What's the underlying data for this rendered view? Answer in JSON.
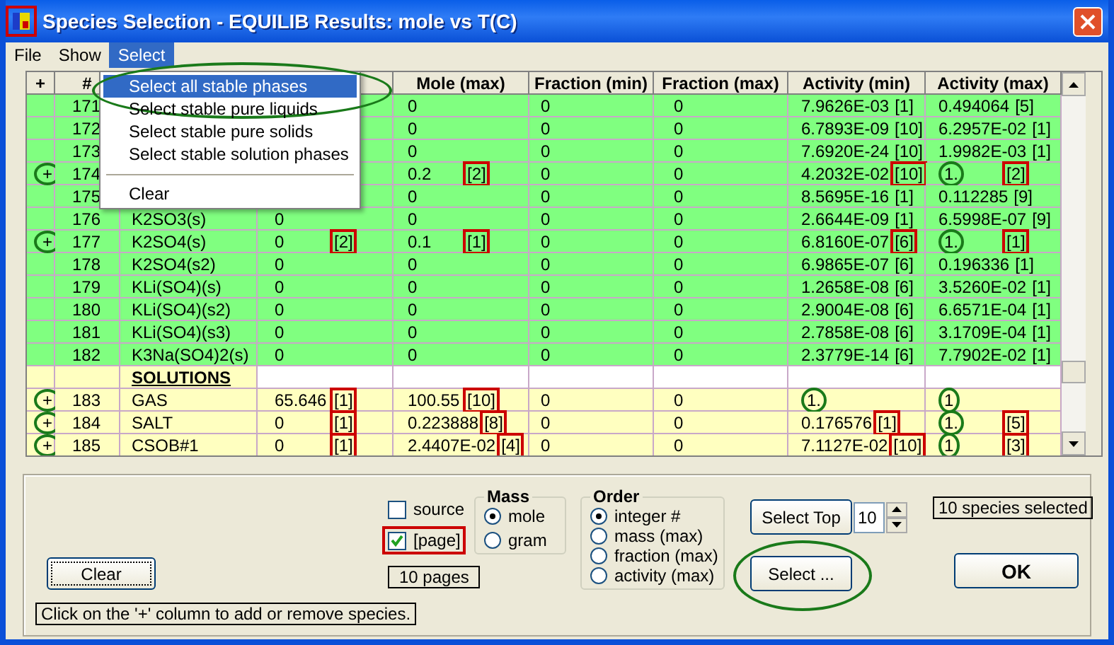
{
  "window": {
    "title": "Species Selection - EQUILIB Results: mole vs T(C)",
    "icon_boxed": true
  },
  "menu": [
    {
      "label": "File",
      "selected": false
    },
    {
      "label": "Show",
      "selected": false
    },
    {
      "label": "Select",
      "selected": true
    }
  ],
  "dropdown": [
    {
      "kind": "item",
      "label": "Select all stable phases",
      "selected": true,
      "circled": true
    },
    {
      "kind": "item",
      "label": "Select stable pure liquids",
      "selected": false,
      "circled": false
    },
    {
      "kind": "item",
      "label": "Select stable pure solids",
      "selected": false,
      "circled": false
    },
    {
      "kind": "item",
      "label": "Select stable solution phases",
      "selected": false,
      "circled": false
    },
    {
      "kind": "separator"
    },
    {
      "kind": "item",
      "label": "Clear",
      "selected": false,
      "circled": false
    }
  ],
  "table": {
    "header": {
      "plus": "+",
      "number": "#",
      "mole_max": "Mole (max)",
      "fraction_min": "Fraction (min)",
      "fraction_max": "Fraction (max)",
      "activity_min": "Activity (min)",
      "activity_max": "Activity (max)"
    },
    "rows": [
      {
        "kind": "pure",
        "number": "171",
        "mole_max": {
          "text": "0"
        },
        "fraction_min": {
          "text": "0"
        },
        "fraction_max": {
          "text": "0"
        },
        "activity_min": {
          "text": "7.9626E-03",
          "tag": "[1]"
        },
        "activity_max": {
          "text": "0.494064",
          "tag": "[5]"
        }
      },
      {
        "kind": "pure",
        "number": "172",
        "mole_max": {
          "text": "0"
        },
        "fraction_min": {
          "text": "0"
        },
        "fraction_max": {
          "text": "0"
        },
        "activity_min": {
          "text": "6.7893E-09",
          "tag": "[10]"
        },
        "activity_max": {
          "text": "6.2957E-02",
          "tag": "[1]"
        }
      },
      {
        "kind": "pure",
        "number": "173",
        "mole_max": {
          "text": "0"
        },
        "fraction_min": {
          "text": "0"
        },
        "fraction_max": {
          "text": "0"
        },
        "activity_min": {
          "text": "7.6920E-24",
          "tag": "[10]"
        },
        "activity_max": {
          "text": "1.9982E-03",
          "tag": "[1]"
        }
      },
      {
        "kind": "pure",
        "plus": "+",
        "plus_circled": true,
        "number": "174",
        "mole_max": {
          "text": "0.2",
          "tag": "[2]",
          "boxed": true
        },
        "fraction_min": {
          "text": "0"
        },
        "fraction_max": {
          "text": "0"
        },
        "activity_min": {
          "text": "4.2032E-02",
          "tag": "[10]",
          "boxed": true
        },
        "activity_max": {
          "text": "1.",
          "circled": true,
          "tag": "[2]",
          "boxed": true
        }
      },
      {
        "kind": "pure",
        "number": "175",
        "mole_max": {
          "text": "0"
        },
        "fraction_min": {
          "text": "0"
        },
        "fraction_max": {
          "text": "0"
        },
        "activity_min": {
          "text": "8.5695E-16",
          "tag": "[1]"
        },
        "activity_max": {
          "text": "0.112285",
          "tag": "[9]"
        }
      },
      {
        "kind": "pure",
        "number": "176",
        "name": "K2SO3(s)",
        "mole_min": {
          "text": "0"
        },
        "mole_max": {
          "text": "0"
        },
        "fraction_min": {
          "text": "0"
        },
        "fraction_max": {
          "text": "0"
        },
        "activity_min": {
          "text": "2.6644E-09",
          "tag": "[1]"
        },
        "activity_max": {
          "text": "6.5998E-07",
          "tag": "[9]"
        }
      },
      {
        "kind": "pure",
        "plus": "+",
        "plus_circled": true,
        "number": "177",
        "name": "K2SO4(s)",
        "mole_min": {
          "text": "0",
          "tag": "[2]",
          "boxed": true
        },
        "mole_max": {
          "text": "0.1",
          "tag": "[1]",
          "boxed": true
        },
        "fraction_min": {
          "text": "0"
        },
        "fraction_max": {
          "text": "0"
        },
        "activity_min": {
          "text": "6.8160E-07",
          "tag": "[6]",
          "boxed": true
        },
        "activity_max": {
          "text": "1.",
          "circled": true,
          "tag": "[1]",
          "boxed": true
        }
      },
      {
        "kind": "pure",
        "number": "178",
        "name": "K2SO4(s2)",
        "mole_min": {
          "text": "0"
        },
        "mole_max": {
          "text": "0"
        },
        "fraction_min": {
          "text": "0"
        },
        "fraction_max": {
          "text": "0"
        },
        "activity_min": {
          "text": "6.9865E-07",
          "tag": "[6]"
        },
        "activity_max": {
          "text": "0.196336",
          "tag": "[1]"
        }
      },
      {
        "kind": "pure",
        "number": "179",
        "name": "KLi(SO4)(s)",
        "mole_min": {
          "text": "0"
        },
        "mole_max": {
          "text": "0"
        },
        "fraction_min": {
          "text": "0"
        },
        "fraction_max": {
          "text": "0"
        },
        "activity_min": {
          "text": "1.2658E-08",
          "tag": "[6]"
        },
        "activity_max": {
          "text": "3.5260E-02",
          "tag": "[1]"
        }
      },
      {
        "kind": "pure",
        "number": "180",
        "name": "KLi(SO4)(s2)",
        "mole_min": {
          "text": "0"
        },
        "mole_max": {
          "text": "0"
        },
        "fraction_min": {
          "text": "0"
        },
        "fraction_max": {
          "text": "0"
        },
        "activity_min": {
          "text": "2.9004E-08",
          "tag": "[6]"
        },
        "activity_max": {
          "text": "6.6571E-04",
          "tag": "[1]"
        }
      },
      {
        "kind": "pure",
        "number": "181",
        "name": "KLi(SO4)(s3)",
        "mole_min": {
          "text": "0"
        },
        "mole_max": {
          "text": "0"
        },
        "fraction_min": {
          "text": "0"
        },
        "fraction_max": {
          "text": "0"
        },
        "activity_min": {
          "text": "2.7858E-08",
          "tag": "[6]"
        },
        "activity_max": {
          "text": "3.1709E-04",
          "tag": "[1]"
        }
      },
      {
        "kind": "pure",
        "number": "182",
        "name": "K3Na(SO4)2(s)",
        "mole_min": {
          "text": "0"
        },
        "mole_max": {
          "text": "0"
        },
        "fraction_min": {
          "text": "0"
        },
        "fraction_max": {
          "text": "0"
        },
        "activity_min": {
          "text": "2.3779E-14",
          "tag": "[6]"
        },
        "activity_max": {
          "text": "7.7902E-02",
          "tag": "[1]"
        }
      },
      {
        "kind": "heading",
        "name": "SOLUTIONS"
      },
      {
        "kind": "solution",
        "plus": "+",
        "plus_circled": true,
        "number": "183",
        "name": "GAS",
        "mole_min": {
          "text": "65.646",
          "tag": "[1]",
          "boxed": true
        },
        "mole_max": {
          "text": "100.55",
          "tag": "[10]",
          "boxed": true
        },
        "fraction_min": {
          "text": "0"
        },
        "fraction_max": {
          "text": "0"
        },
        "activity_min": {
          "text": "1.",
          "circled": true
        },
        "activity_max": {
          "text": "1",
          "circled": true
        }
      },
      {
        "kind": "solution",
        "plus": "+",
        "plus_circled": true,
        "number": "184",
        "name": "SALT",
        "mole_min": {
          "text": "0",
          "tag": "[1]",
          "boxed": true
        },
        "mole_max": {
          "text": "0.223888",
          "tag": "[8]",
          "boxed": true
        },
        "fraction_min": {
          "text": "0"
        },
        "fraction_max": {
          "text": "0"
        },
        "activity_min": {
          "text": "0.176576",
          "tag": "[1]",
          "boxed": true
        },
        "activity_max": {
          "text": "1.",
          "circled": true,
          "tag": "[5]",
          "boxed": true
        }
      },
      {
        "kind": "solution",
        "plus": "+",
        "plus_circled": true,
        "number": "185",
        "name": "CSOB#1",
        "mole_min": {
          "text": "0",
          "tag": "[1]",
          "boxed": true
        },
        "mole_max": {
          "text": "2.4407E-02",
          "tag": "[4]",
          "boxed": true
        },
        "fraction_min": {
          "text": "0"
        },
        "fraction_max": {
          "text": "0"
        },
        "activity_min": {
          "text": "7.1127E-02",
          "tag": "[10]",
          "boxed": true
        },
        "activity_max": {
          "text": "1",
          "circled": true,
          "tag": "[3]",
          "boxed": true
        }
      }
    ]
  },
  "options": {
    "clear_button": "Clear",
    "hint": "Click on the '+' column to add or remove species.",
    "checkboxes": [
      {
        "label": "source",
        "checked": false,
        "boxed": false
      },
      {
        "label": "[page]",
        "checked": true,
        "boxed": true
      }
    ],
    "pages": "10 pages",
    "mass": {
      "title": "Mass",
      "options": [
        {
          "label": "mole",
          "selected": true
        },
        {
          "label": "gram",
          "selected": false
        }
      ]
    },
    "order": {
      "title": "Order",
      "options": [
        {
          "label": "integer #",
          "selected": true
        },
        {
          "label": "mass (max)",
          "selected": false
        },
        {
          "label": "fraction (max)",
          "selected": false
        },
        {
          "label": "activity (max)",
          "selected": false
        }
      ]
    },
    "select_top_button": "Select Top",
    "top_count": "10",
    "select_button": {
      "label": "Select ...",
      "circled": true
    },
    "selected_count": "10 species selected",
    "ok_button": "OK"
  }
}
